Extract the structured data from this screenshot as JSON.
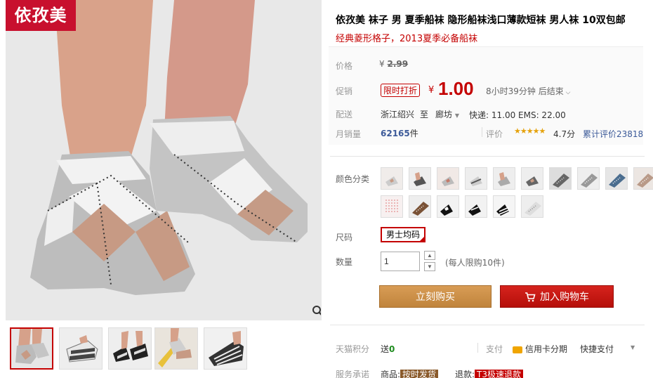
{
  "brand": {
    "logo_text": "依孜美"
  },
  "gallery": {
    "thumbnails": [
      "thumb-1",
      "thumb-2",
      "thumb-3",
      "thumb-4",
      "thumb-5"
    ],
    "zoom_icon": "magnifier-icon"
  },
  "product": {
    "title": "依孜美 袜子 男 夏季船袜 隐形船袜浅口薄款短袜 男人袜 10双包邮",
    "subtitle": "经典菱形格子，2013夏季必备船袜"
  },
  "price": {
    "label": "价格",
    "currency": "¥",
    "original": "2.99",
    "promo_label": "促销",
    "promo_badge": "限时打折",
    "promo_currency": "¥",
    "promo_price": "1.00",
    "countdown": "8小时39分钟 后结束"
  },
  "shipping": {
    "label": "配送",
    "from": "浙江绍兴",
    "to_word": "至",
    "to": "廊坊",
    "fees": "快递: 11.00 EMS: 22.00"
  },
  "sales": {
    "label": "月销量",
    "count": "62165",
    "unit": "件",
    "rating_label": "评价",
    "stars": "★★★★★",
    "score": "4.7分",
    "total_reviews": "累计评价23818"
  },
  "options": {
    "color_label": "颜色分类",
    "size_label": "尺码",
    "size_value": "男士均码",
    "qty_label": "数量",
    "qty_value": "1",
    "qty_note": "(每人限购10件)"
  },
  "actions": {
    "buy_now": "立刻购买",
    "add_to_cart": "加入购物车"
  },
  "extras": {
    "points_label": "天猫积分",
    "points_value": "送",
    "points_amount": "0",
    "pay_label": "支付",
    "card_pay": "信用卡分期",
    "quick_pay": "快捷支付",
    "service_label": "服务承诺",
    "goods_label": "商品:",
    "goods_tag": "按时发货",
    "refund_label": "退款:",
    "refund_tag": "T3极速退款"
  },
  "colors": {
    "accent": "#c40000",
    "buy": "#c98d45",
    "cart": "#c8150f"
  }
}
